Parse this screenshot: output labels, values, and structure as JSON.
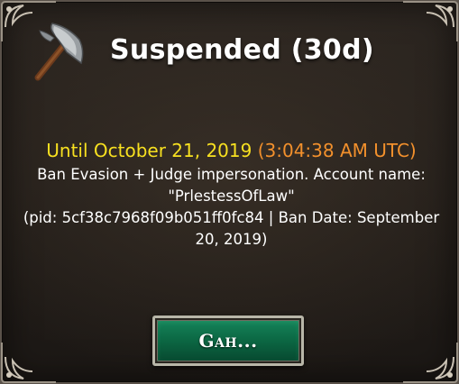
{
  "dialog": {
    "title": "Suspended (30d)",
    "icon": "battle-axe-icon",
    "until_date": "Until October 21, 2019",
    "until_time": "(3:04:38 AM UTC)",
    "reason": "Ban Evasion + Judge impersonation. Account name:",
    "account_name": "\"PrlestessOfLaw\"",
    "details_line1": "(pid: 5cf38c7968f09b051ff0fc84 | Ban Date: September",
    "details_line2": "20, 2019)",
    "button_label": "Gah..."
  },
  "colors": {
    "until": "#f7e020",
    "utc": "#f2902c",
    "button": "#0c6a45"
  }
}
